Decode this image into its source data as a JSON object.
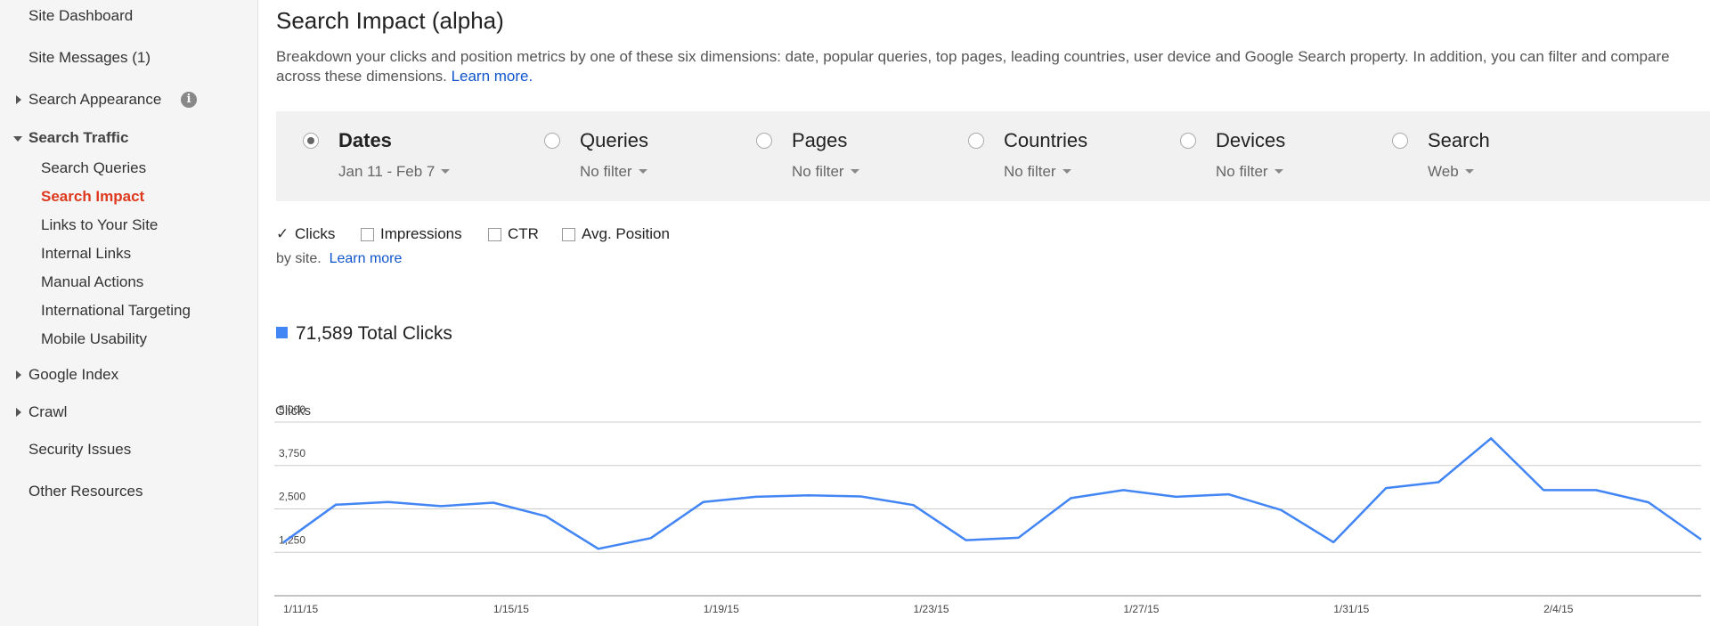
{
  "sidebar": {
    "items": [
      {
        "label": "Site Dashboard"
      },
      {
        "label": "Site Messages (1)"
      },
      {
        "label": "Search Appearance"
      },
      {
        "label": "Search Traffic"
      },
      {
        "label": "Search Queries"
      },
      {
        "label": "Search Impact"
      },
      {
        "label": "Links to Your Site"
      },
      {
        "label": "Internal Links"
      },
      {
        "label": "Manual Actions"
      },
      {
        "label": "International Targeting"
      },
      {
        "label": "Mobile Usability"
      },
      {
        "label": "Google Index"
      },
      {
        "label": "Crawl"
      },
      {
        "label": "Security Issues"
      },
      {
        "label": "Other Resources"
      }
    ],
    "info_icon": "i"
  },
  "main": {
    "title": "Search Impact (alpha)",
    "description": "Breakdown your clicks and position metrics by one of these six dimensions: date, popular queries, top pages, leading countries, user device and Google Search property. In addition, you can filter and compare across these dimensions.",
    "learn_more": "Learn more.",
    "dimensions": [
      {
        "label": "Dates",
        "filter": "Jan 11 - Feb 7",
        "selected": true
      },
      {
        "label": "Queries",
        "filter": "No filter",
        "selected": false
      },
      {
        "label": "Pages",
        "filter": "No filter",
        "selected": false
      },
      {
        "label": "Countries",
        "filter": "No filter",
        "selected": false
      },
      {
        "label": "Devices",
        "filter": "No filter",
        "selected": false
      },
      {
        "label": "Search",
        "filter": "Web",
        "selected": false
      }
    ],
    "metrics": [
      {
        "label": "Clicks",
        "checked": true
      },
      {
        "label": "Impressions",
        "checked": false
      },
      {
        "label": "CTR",
        "checked": false
      },
      {
        "label": "Avg. Position",
        "checked": false
      }
    ],
    "by_site": "by site.",
    "by_site_link": "Learn more",
    "total": "71,589 Total Clicks"
  },
  "colors": {
    "accent": "#4285f4",
    "active_nav": "#dd3a1f",
    "link": "#1155cc"
  },
  "chart_data": {
    "type": "line",
    "ylabel": "Clicks",
    "ylim": [
      0,
      5000
    ],
    "yticks": [
      "1,250",
      "2,500",
      "3,750",
      "5,000"
    ],
    "xticks": [
      "1/11/15",
      "1/15/15",
      "1/19/15",
      "1/23/15",
      "1/27/15",
      "1/31/15",
      "2/4/15"
    ],
    "x": [
      "1/11/15",
      "1/12/15",
      "1/13/15",
      "1/14/15",
      "1/15/15",
      "1/16/15",
      "1/17/15",
      "1/18/15",
      "1/19/15",
      "1/20/15",
      "1/21/15",
      "1/22/15",
      "1/23/15",
      "1/24/15",
      "1/25/15",
      "1/26/15",
      "1/27/15",
      "1/28/15",
      "1/29/15",
      "1/30/15",
      "1/31/15",
      "2/1/15",
      "2/2/15",
      "2/3/15",
      "2/4/15",
      "2/5/15",
      "2/6/15",
      "2/7/15"
    ],
    "series": [
      {
        "values": [
          1530,
          2620,
          2700,
          2580,
          2680,
          2290,
          1350,
          1660,
          2700,
          2850,
          2890,
          2860,
          2610,
          1600,
          1670,
          2810,
          3040,
          2850,
          2920,
          2470,
          1540,
          3100,
          3270,
          4530,
          3040,
          3040,
          2690,
          1620
        ]
      }
    ],
    "grid": true,
    "color": "#4285f4"
  }
}
